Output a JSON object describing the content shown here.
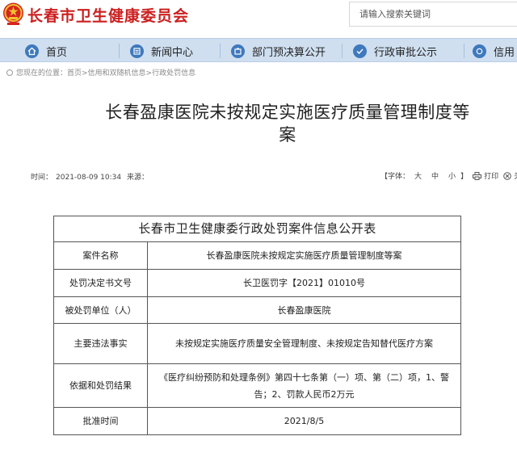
{
  "header": {
    "site_title": "长春市卫生健康委员会",
    "search_placeholder": "请输入搜索关键词"
  },
  "nav": {
    "items": [
      {
        "label": "首页",
        "icon": "home-icon"
      },
      {
        "label": "新闻中心",
        "icon": "news-icon"
      },
      {
        "label": "部门预决算公开",
        "icon": "budget-icon"
      },
      {
        "label": "行政审批公示",
        "icon": "approval-icon"
      },
      {
        "label": "信用",
        "icon": "credit-icon"
      }
    ]
  },
  "breadcrumb": "您现在的位置：首页>信用和双随机信息>行政处罚信息",
  "article": {
    "title_line1": "长春盈康医院未按规定实施医疗质量管理制度等",
    "title_line2": "案",
    "time_label": "时间：",
    "time_value": "2021-08-09 10:34",
    "source_label": "来源：",
    "font_label": "【字体：",
    "font_large": "大",
    "font_medium": "中",
    "font_small": "小",
    "font_close": "】",
    "print_label": "打印",
    "close_label": "关闭"
  },
  "table": {
    "title": "长春市卫生健康委行政处罚案件信息公开表",
    "rows": [
      {
        "label": "案件名称",
        "value": "长春盈康医院未按规定实施医疗质量管理制度等案"
      },
      {
        "label": "处罚决定书文号",
        "value": "长卫医罚字【2021】01010号"
      },
      {
        "label": "被处罚单位（人）",
        "value": "长春盈康医院"
      },
      {
        "label": "主要违法事实",
        "value": "未按规定实施医疗质量安全管理制度、未按规定告知替代医疗方案"
      },
      {
        "label": "依据和处罚结果",
        "value": "《医疗纠纷预防和处理条例》第四十七条第（一）项、第（二）项，1、警告；2、罚款人民币2万元"
      },
      {
        "label": "批准时间",
        "value": "2021/8/5"
      }
    ]
  },
  "colors": {
    "brand_red": "#cc1f1f",
    "nav_bg": "#cfdff0",
    "nav_icon": "#3f79bd"
  }
}
